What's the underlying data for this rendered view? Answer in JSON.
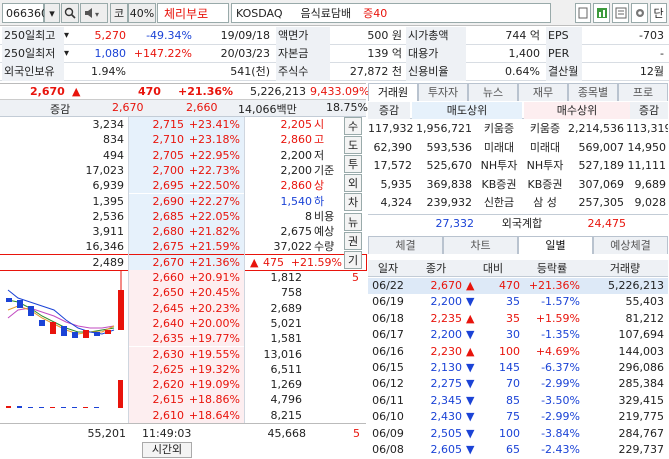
{
  "toolbar": {
    "code": "066360",
    "market_flag": "코",
    "ratio": "40%",
    "name": "체리부로",
    "exchange": "KOSDAQ",
    "sector": "음식료담배",
    "margin": "증40",
    "btn_search": "search-icon",
    "btn_sound": "speaker-icon",
    "btn_settings": "gear-icon",
    "btn_extra": "단"
  },
  "info": {
    "rows": [
      [
        "250일최고",
        "5,270",
        "-49.34%",
        "19/09/18",
        "액면가",
        "500 원",
        "시가총액",
        "744 억",
        "EPS",
        "-703"
      ],
      [
        "250일최저",
        "1,080",
        "+147.22%",
        "20/03/23",
        "자본금",
        "139 억",
        "대용가",
        "1,400",
        "PER",
        "-"
      ],
      [
        "외국인보유",
        "1.94%",
        "",
        "541(천)",
        "주식수",
        "27,872 천",
        "신용비율",
        "0.64%",
        "결산월",
        "12월"
      ]
    ]
  },
  "price": {
    "current": "2,670",
    "arrow": "▲",
    "change": "470",
    "pct": "+21.36%",
    "volume": "5,226,213",
    "amount": "9,433.09%"
  },
  "ob_header": {
    "label": "증감",
    "ask_top": "2,670",
    "bid_top": "2,660",
    "value": "14,066백만",
    "ratio": "18.75%"
  },
  "asks": [
    {
      "qty": "3,234",
      "price": "2,715",
      "pct": "+23.41%"
    },
    {
      "qty": "834",
      "price": "2,710",
      "pct": "+23.18%"
    },
    {
      "qty": "494",
      "price": "2,705",
      "pct": "+22.95%"
    },
    {
      "qty": "17,023",
      "price": "2,700",
      "pct": "+22.73%"
    },
    {
      "qty": "6,939",
      "price": "2,695",
      "pct": "+22.50%"
    },
    {
      "qty": "1,395",
      "price": "2,690",
      "pct": "+22.27%"
    },
    {
      "qty": "2,536",
      "price": "2,685",
      "pct": "+22.05%"
    },
    {
      "qty": "3,911",
      "price": "2,680",
      "pct": "+21.82%"
    },
    {
      "qty": "16,346",
      "price": "2,675",
      "pct": "+21.59%"
    },
    {
      "qty": "2,489",
      "price": "2,670",
      "pct": "+21.36%"
    }
  ],
  "stats": [
    {
      "value": "2,205",
      "label": "시"
    },
    {
      "value": "2,860",
      "label": "고"
    },
    {
      "value": "2,200",
      "label": "저"
    },
    {
      "value": "2,200",
      "label": "기준"
    },
    {
      "value": "2,860",
      "label": "상"
    },
    {
      "value": "1,540",
      "label": "하"
    },
    {
      "value": "8",
      "label": "비용"
    },
    {
      "value": "2,675",
      "label": "예상"
    },
    {
      "value": "37,022",
      "label": "수량"
    }
  ],
  "expect": {
    "arrow": "▲",
    "change": "475",
    "pct": "+21.59%"
  },
  "side_buttons": [
    "수",
    "도",
    "투",
    "외",
    "차",
    "뉴",
    "권",
    "기"
  ],
  "bids": [
    {
      "price": "2,660",
      "pct": "+20.91%",
      "qty": "1,812"
    },
    {
      "price": "2,650",
      "pct": "+20.45%",
      "qty": "758"
    },
    {
      "price": "2,645",
      "pct": "+20.23%",
      "qty": "2,689"
    },
    {
      "price": "2,640",
      "pent": "",
      "pct": "+20.00%",
      "qty": "5,021"
    },
    {
      "price": "2,635",
      "pct": "+19.77%",
      "qty": "1,581"
    },
    {
      "price": "2,630",
      "pct": "+19.55%",
      "qty": "13,016"
    },
    {
      "price": "2,625",
      "pct": "+19.32%",
      "qty": "6,511"
    },
    {
      "price": "2,620",
      "pct": "+19.09%",
      "qty": "1,269"
    },
    {
      "price": "2,615",
      "pct": "+18.86%",
      "qty": "4,796"
    },
    {
      "price": "2,610",
      "pct": "+18.64%",
      "qty": "8,215"
    }
  ],
  "bid_marker": "5",
  "footer": {
    "ask_total": "55,201",
    "time": "11:49:03",
    "time_label": "시간외",
    "bid_total": "45,668",
    "last": "5"
  },
  "broker": {
    "tabs": [
      "거래원",
      "투자자",
      "뉴스",
      "재무",
      "종목별",
      "프로"
    ],
    "headers": [
      "증감",
      "매도상위",
      "매수상위",
      "증감"
    ],
    "rows": [
      [
        "117,932",
        "1,956,721",
        "키움증",
        "키움증",
        "2,214,536",
        "113,319"
      ],
      [
        "62,390",
        "593,536",
        "미래대",
        "미래대",
        "569,007",
        "14,950"
      ],
      [
        "17,572",
        "525,670",
        "NH투자",
        "NH투자",
        "527,189",
        "11,111"
      ],
      [
        "5,935",
        "369,838",
        "KB증권",
        "KB증권",
        "307,069",
        "9,689"
      ],
      [
        "4,324",
        "239,932",
        "신한금",
        "삼 성",
        "257,305",
        "9,028"
      ]
    ],
    "foreign": {
      "sell": "27,332",
      "label": "외국계합",
      "buy": "24,475"
    }
  },
  "daily": {
    "tabs": [
      "체결",
      "차트",
      "일별",
      "예상체결"
    ],
    "headers": [
      "일자",
      "종가",
      "대비",
      "등락률",
      "거래량"
    ],
    "rows": [
      {
        "date": "06/22",
        "close": "2,670",
        "dir": "up",
        "diff": "470",
        "rate": "+21.36%",
        "vol": "5,226,213"
      },
      {
        "date": "06/19",
        "close": "2,200",
        "dir": "down",
        "diff": "35",
        "rate": "-1.57%",
        "vol": "55,403"
      },
      {
        "date": "06/18",
        "close": "2,235",
        "dir": "up",
        "diff": "35",
        "rate": "+1.59%",
        "vol": "81,212"
      },
      {
        "date": "06/17",
        "close": "2,200",
        "dir": "down",
        "diff": "30",
        "rate": "-1.35%",
        "vol": "107,694"
      },
      {
        "date": "06/16",
        "close": "2,230",
        "dir": "up",
        "diff": "100",
        "rate": "+4.69%",
        "vol": "144,003"
      },
      {
        "date": "06/15",
        "close": "2,130",
        "dir": "down",
        "diff": "145",
        "rate": "-6.37%",
        "vol": "296,086"
      },
      {
        "date": "06/12",
        "close": "2,275",
        "dir": "down",
        "diff": "70",
        "rate": "-2.99%",
        "vol": "285,384"
      },
      {
        "date": "06/11",
        "close": "2,345",
        "dir": "down",
        "diff": "85",
        "rate": "-3.50%",
        "vol": "329,415"
      },
      {
        "date": "06/10",
        "close": "2,430",
        "dir": "down",
        "diff": "75",
        "rate": "-2.99%",
        "vol": "219,775"
      },
      {
        "date": "06/09",
        "close": "2,505",
        "dir": "down",
        "diff": "100",
        "rate": "-3.84%",
        "vol": "284,767"
      },
      {
        "date": "06/08",
        "close": "2,605",
        "dir": "down",
        "diff": "65",
        "rate": "-2.43%",
        "vol": "229,737"
      }
    ]
  },
  "colors": {
    "up": "#e8140c",
    "down": "#1b43d6",
    "ask_bg": "#e6f1fb",
    "bid_bg": "#fdeef0"
  }
}
